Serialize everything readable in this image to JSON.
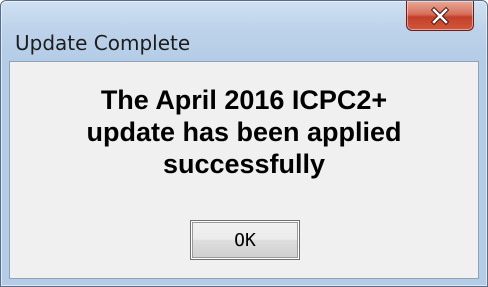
{
  "window": {
    "title": "Update Complete"
  },
  "message": {
    "line1": "The April 2016 ICPC2+",
    "line2": "update has been applied",
    "line3": "successfully"
  },
  "buttons": {
    "ok_label": "OK",
    "close_icon": "close-icon"
  },
  "colors": {
    "title_bar": "#bcd2ea",
    "close_button": "#c2402a",
    "client_background": "#f0f0f0"
  }
}
